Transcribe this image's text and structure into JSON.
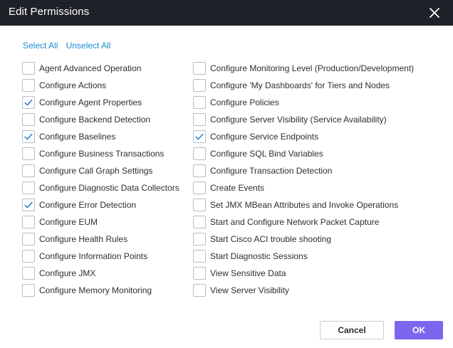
{
  "dialog": {
    "title": "Edit Permissions",
    "close_icon": "close-icon"
  },
  "links": {
    "select_all": "Select All",
    "unselect_all": "Unselect All"
  },
  "permissions": {
    "left": [
      {
        "label": "Agent Advanced Operation",
        "checked": false
      },
      {
        "label": "Configure Actions",
        "checked": false
      },
      {
        "label": "Configure Agent Properties",
        "checked": true
      },
      {
        "label": "Configure Backend Detection",
        "checked": false
      },
      {
        "label": "Configure Baselines",
        "checked": true
      },
      {
        "label": "Configure Business Transactions",
        "checked": false
      },
      {
        "label": "Configure Call Graph Settings",
        "checked": false
      },
      {
        "label": "Configure Diagnostic Data Collectors",
        "checked": false
      },
      {
        "label": "Configure Error Detection",
        "checked": true
      },
      {
        "label": "Configure EUM",
        "checked": false
      },
      {
        "label": "Configure Health Rules",
        "checked": false
      },
      {
        "label": "Configure Information Points",
        "checked": false
      },
      {
        "label": "Configure JMX",
        "checked": false
      },
      {
        "label": "Configure Memory Monitoring",
        "checked": false
      }
    ],
    "right": [
      {
        "label": "Configure Monitoring Level (Production/Development)",
        "checked": false
      },
      {
        "label": "Configure 'My Dashboards' for Tiers and Nodes",
        "checked": false
      },
      {
        "label": "Configure Policies",
        "checked": false
      },
      {
        "label": "Configure Server Visibility (Service Availability)",
        "checked": false
      },
      {
        "label": "Configure Service Endpoints",
        "checked": true
      },
      {
        "label": "Configure SQL Bind Variables",
        "checked": false
      },
      {
        "label": "Configure Transaction Detection",
        "checked": false
      },
      {
        "label": "Create Events",
        "checked": false
      },
      {
        "label": "Set JMX MBean Attributes and Invoke Operations",
        "checked": false
      },
      {
        "label": "Start and Configure Network Packet Capture",
        "checked": false
      },
      {
        "label": "Start Cisco ACI trouble shooting",
        "checked": false
      },
      {
        "label": "Start Diagnostic Sessions",
        "checked": false
      },
      {
        "label": "View Sensitive Data",
        "checked": false
      },
      {
        "label": "View Server Visibility",
        "checked": false
      }
    ]
  },
  "buttons": {
    "cancel": "Cancel",
    "ok": "OK"
  },
  "colors": {
    "titlebar": "#1f2128",
    "link": "#1a8ad3",
    "checkmark": "#2f86d6",
    "ok_button": "#7b67ee"
  }
}
